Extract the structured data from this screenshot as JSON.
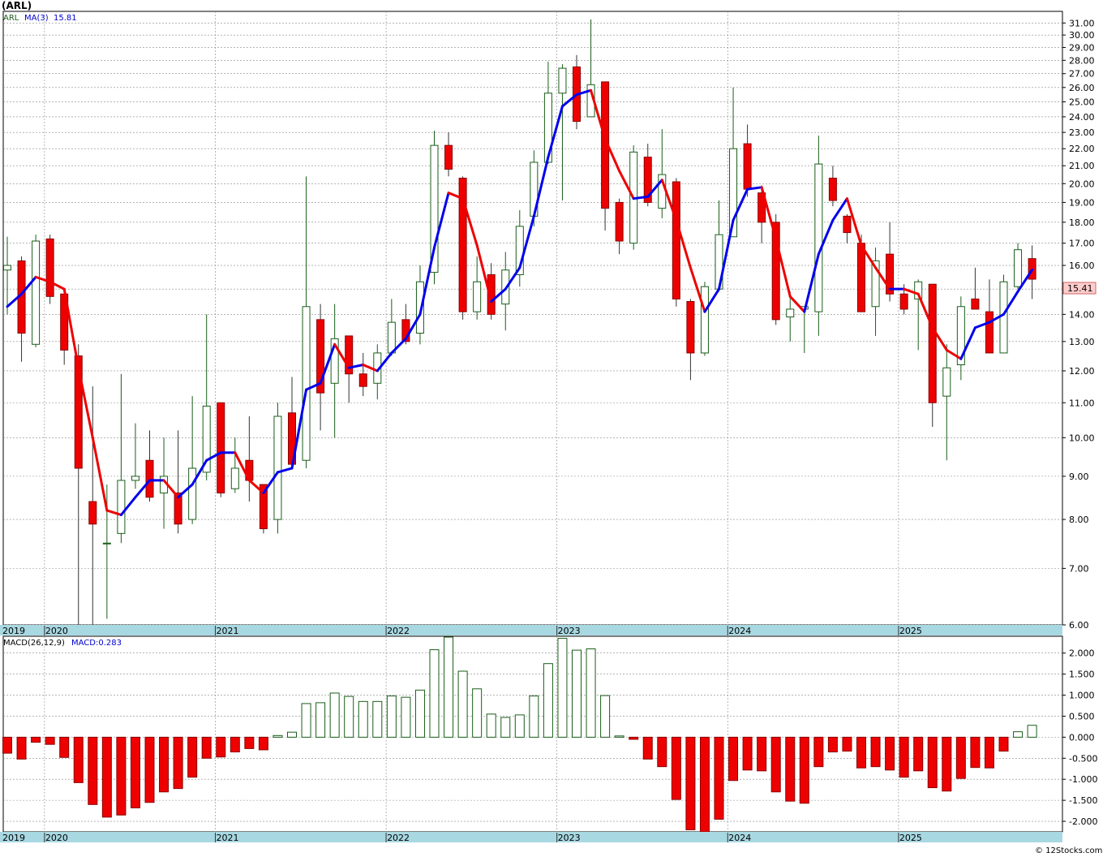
{
  "header": {
    "symbol_title": "(ARL)",
    "legend_symbol": "ARL",
    "legend_ma": "MA(3)",
    "legend_ma_value": "15.81",
    "macd_label": "MACD(26,12,9)",
    "macd_value": "MACD:0.283",
    "last_price_tag": "15.41",
    "copyright": "© 12Stocks.com"
  },
  "colors": {
    "up_candle_stroke": "#1a5e1a",
    "up_candle_fill": "#ffffff",
    "down_candle_fill": "#ee0000",
    "ma_up": "#0000ee",
    "ma_down": "#ee0000",
    "grid": "#888888",
    "axis_band": "#a8d8e2",
    "price_tag_bg": "#ffcccc"
  },
  "chart_data": [
    {
      "type": "candlestick",
      "name": "price",
      "y_scale": "log",
      "ylim": [
        6.0,
        32.0
      ],
      "y_ticks": [
        6,
        7,
        8,
        9,
        10,
        11,
        12,
        13,
        14,
        15,
        16,
        17,
        18,
        19,
        20,
        21,
        22,
        23,
        24,
        25,
        26,
        27,
        28,
        29,
        30,
        31
      ],
      "y_tick_labels": [
        "6.00",
        "7.00",
        "8.00",
        "9.00",
        "10.00",
        "11.00",
        "12.00",
        "13.00",
        "14.00",
        "15.00",
        "16.00",
        "17.00",
        "18.00",
        "19.00",
        "20.00",
        "21.00",
        "22.00",
        "23.00",
        "24.00",
        "25.00",
        "26.00",
        "27.00",
        "28.00",
        "29.00",
        "30.00",
        "31.00"
      ],
      "x_year_labels": [
        "2019",
        "2020",
        "2021",
        "2022",
        "2023",
        "2024",
        "2025"
      ],
      "grid": true,
      "ma_period": 3,
      "candles": [
        {
          "o": 15.8,
          "h": 17.3,
          "l": 14.0,
          "c": 16.0
        },
        {
          "o": 16.2,
          "h": 16.4,
          "l": 12.3,
          "c": 13.3
        },
        {
          "o": 12.9,
          "h": 17.4,
          "l": 12.8,
          "c": 17.1
        },
        {
          "o": 17.2,
          "h": 17.4,
          "l": 14.4,
          "c": 14.7
        },
        {
          "o": 14.8,
          "h": 14.8,
          "l": 12.2,
          "c": 12.7
        },
        {
          "o": 12.5,
          "h": 12.9,
          "l": 5.9,
          "c": 9.2
        },
        {
          "o": 8.4,
          "h": 11.5,
          "l": 5.9,
          "c": 7.9
        },
        {
          "o": 7.5,
          "h": 8.8,
          "l": 6.1,
          "c": 7.5
        },
        {
          "o": 7.7,
          "h": 11.9,
          "l": 7.5,
          "c": 8.9
        },
        {
          "o": 8.9,
          "h": 10.4,
          "l": 8.7,
          "c": 9.0
        },
        {
          "o": 9.4,
          "h": 10.2,
          "l": 8.4,
          "c": 8.5
        },
        {
          "o": 8.6,
          "h": 10.0,
          "l": 7.8,
          "c": 9.0
        },
        {
          "o": 8.6,
          "h": 10.2,
          "l": 7.7,
          "c": 7.9
        },
        {
          "o": 8.0,
          "h": 11.2,
          "l": 7.9,
          "c": 9.2
        },
        {
          "o": 9.1,
          "h": 14.0,
          "l": 8.9,
          "c": 10.9
        },
        {
          "o": 11.0,
          "h": 11.0,
          "l": 8.5,
          "c": 8.6
        },
        {
          "o": 8.7,
          "h": 10.0,
          "l": 8.6,
          "c": 9.2
        },
        {
          "o": 9.4,
          "h": 10.6,
          "l": 8.4,
          "c": 8.9
        },
        {
          "o": 8.8,
          "h": 8.8,
          "l": 7.7,
          "c": 7.8
        },
        {
          "o": 8.0,
          "h": 11.0,
          "l": 7.7,
          "c": 10.6
        },
        {
          "o": 10.7,
          "h": 11.8,
          "l": 9.2,
          "c": 9.3
        },
        {
          "o": 9.4,
          "h": 20.4,
          "l": 9.2,
          "c": 14.3
        },
        {
          "o": 13.8,
          "h": 14.4,
          "l": 10.2,
          "c": 11.3
        },
        {
          "o": 11.6,
          "h": 14.4,
          "l": 10.0,
          "c": 13.1
        },
        {
          "o": 13.2,
          "h": 13.2,
          "l": 11.0,
          "c": 11.9
        },
        {
          "o": 11.9,
          "h": 12.6,
          "l": 11.2,
          "c": 11.5
        },
        {
          "o": 11.6,
          "h": 12.9,
          "l": 11.1,
          "c": 12.6
        },
        {
          "o": 12.6,
          "h": 14.6,
          "l": 12.5,
          "c": 13.7
        },
        {
          "o": 13.8,
          "h": 14.4,
          "l": 12.9,
          "c": 13.0
        },
        {
          "o": 13.3,
          "h": 16.0,
          "l": 12.9,
          "c": 15.3
        },
        {
          "o": 15.7,
          "h": 23.1,
          "l": 15.2,
          "c": 22.2
        },
        {
          "o": 22.2,
          "h": 23.0,
          "l": 20.4,
          "c": 20.8
        },
        {
          "o": 20.3,
          "h": 20.4,
          "l": 13.8,
          "c": 14.1
        },
        {
          "o": 14.1,
          "h": 16.4,
          "l": 13.8,
          "c": 15.3
        },
        {
          "o": 15.6,
          "h": 16.1,
          "l": 13.8,
          "c": 14.0
        },
        {
          "o": 14.4,
          "h": 16.6,
          "l": 13.4,
          "c": 15.8
        },
        {
          "o": 15.6,
          "h": 18.6,
          "l": 15.1,
          "c": 17.8
        },
        {
          "o": 18.3,
          "h": 21.9,
          "l": 17.8,
          "c": 21.2
        },
        {
          "o": 21.2,
          "h": 27.9,
          "l": 21.1,
          "c": 25.6
        },
        {
          "o": 25.6,
          "h": 27.7,
          "l": 19.1,
          "c": 27.4
        },
        {
          "o": 27.5,
          "h": 28.4,
          "l": 23.2,
          "c": 23.7
        },
        {
          "o": 24.0,
          "h": 31.3,
          "l": 24.0,
          "c": 26.2
        },
        {
          "o": 26.4,
          "h": 26.4,
          "l": 17.6,
          "c": 18.7
        },
        {
          "o": 19.0,
          "h": 19.2,
          "l": 16.5,
          "c": 17.1
        },
        {
          "o": 17.0,
          "h": 22.2,
          "l": 16.7,
          "c": 21.8
        },
        {
          "o": 21.5,
          "h": 22.3,
          "l": 18.8,
          "c": 19.0
        },
        {
          "o": 18.7,
          "h": 23.2,
          "l": 18.2,
          "c": 20.5
        },
        {
          "o": 20.1,
          "h": 20.3,
          "l": 14.3,
          "c": 14.6
        },
        {
          "o": 14.5,
          "h": 14.6,
          "l": 11.7,
          "c": 12.6
        },
        {
          "o": 12.6,
          "h": 15.3,
          "l": 12.5,
          "c": 15.1
        },
        {
          "o": 15.0,
          "h": 19.1,
          "l": 14.9,
          "c": 17.4
        },
        {
          "o": 17.3,
          "h": 26.0,
          "l": 17.3,
          "c": 22.0
        },
        {
          "o": 22.3,
          "h": 23.5,
          "l": 19.3,
          "c": 19.7
        },
        {
          "o": 19.5,
          "h": 19.9,
          "l": 17.0,
          "c": 18.0
        },
        {
          "o": 18.0,
          "h": 18.4,
          "l": 13.6,
          "c": 13.8
        },
        {
          "o": 13.9,
          "h": 14.9,
          "l": 13.0,
          "c": 14.2
        },
        {
          "o": 14.2,
          "h": 14.3,
          "l": 12.6,
          "c": 14.3
        },
        {
          "o": 14.1,
          "h": 22.8,
          "l": 13.2,
          "c": 21.1
        },
        {
          "o": 20.3,
          "h": 21.0,
          "l": 18.8,
          "c": 19.1
        },
        {
          "o": 18.3,
          "h": 18.4,
          "l": 17.0,
          "c": 17.5
        },
        {
          "o": 17.0,
          "h": 17.4,
          "l": 14.1,
          "c": 14.1
        },
        {
          "o": 14.3,
          "h": 16.8,
          "l": 13.2,
          "c": 16.2
        },
        {
          "o": 16.5,
          "h": 18.0,
          "l": 14.5,
          "c": 14.8
        },
        {
          "o": 14.8,
          "h": 15.2,
          "l": 14.0,
          "c": 14.2
        },
        {
          "o": 14.6,
          "h": 15.4,
          "l": 12.7,
          "c": 15.3
        },
        {
          "o": 15.2,
          "h": 15.2,
          "l": 10.3,
          "c": 11.0
        },
        {
          "o": 11.2,
          "h": 12.9,
          "l": 9.4,
          "c": 12.1
        },
        {
          "o": 12.2,
          "h": 14.7,
          "l": 11.7,
          "c": 14.3
        },
        {
          "o": 14.6,
          "h": 15.9,
          "l": 14.2,
          "c": 14.2
        },
        {
          "o": 14.1,
          "h": 15.4,
          "l": 12.6,
          "c": 12.6
        },
        {
          "o": 12.6,
          "h": 15.6,
          "l": 12.6,
          "c": 15.3
        },
        {
          "o": 15.1,
          "h": 17.0,
          "l": 15.0,
          "c": 16.7
        },
        {
          "o": 16.3,
          "h": 16.9,
          "l": 14.6,
          "c": 15.41
        }
      ],
      "ma": [
        14.3,
        14.8,
        15.5,
        15.3,
        15.0,
        12.1,
        10.0,
        8.2,
        8.1,
        8.5,
        8.9,
        8.9,
        8.5,
        8.8,
        9.4,
        9.6,
        9.6,
        8.9,
        8.6,
        9.1,
        9.2,
        11.4,
        11.6,
        12.9,
        12.1,
        12.2,
        12.0,
        12.6,
        13.1,
        14.0,
        16.8,
        19.5,
        19.2,
        16.9,
        14.5,
        15.0,
        15.9,
        18.3,
        21.5,
        24.7,
        25.5,
        25.8,
        22.6,
        20.7,
        19.2,
        19.3,
        20.2,
        18.1,
        15.9,
        14.1,
        15.0,
        18.1,
        19.7,
        19.8,
        17.2,
        14.7,
        14.1,
        16.5,
        18.1,
        19.2,
        16.9,
        15.9,
        15.0,
        15.0,
        14.8,
        13.5,
        12.7,
        12.4,
        13.5,
        13.7,
        14.0,
        14.9,
        15.81
      ]
    },
    {
      "type": "bar",
      "name": "macd-histogram",
      "ylim": [
        -2.25,
        2.4
      ],
      "y_ticks": [
        -2.0,
        -1.5,
        -1.0,
        -0.5,
        0.0,
        0.5,
        1.0,
        1.5,
        2.0
      ],
      "y_tick_labels": [
        "-2.000",
        "-1.500",
        "-1.000",
        "-0.500",
        "0.000",
        "0.500",
        "1.000",
        "1.500",
        "2.000"
      ],
      "x_year_labels": [
        "2019",
        "2020",
        "2021",
        "2022",
        "2023",
        "2024",
        "2025"
      ],
      "values": [
        -0.38,
        -0.52,
        -0.12,
        -0.17,
        -0.48,
        -1.08,
        -1.6,
        -1.9,
        -1.85,
        -1.68,
        -1.55,
        -1.3,
        -1.22,
        -0.95,
        -0.5,
        -0.47,
        -0.35,
        -0.27,
        -0.3,
        0.04,
        0.12,
        0.8,
        0.82,
        1.05,
        0.97,
        0.85,
        0.85,
        0.98,
        0.95,
        1.12,
        2.08,
        2.38,
        1.57,
        1.15,
        0.55,
        0.47,
        0.53,
        0.98,
        1.75,
        2.35,
        2.07,
        2.1,
        0.99,
        0.03,
        -0.05,
        -0.52,
        -0.7,
        -1.48,
        -2.2,
        -2.25,
        -1.95,
        -1.03,
        -0.78,
        -0.8,
        -1.3,
        -1.52,
        -1.57,
        -0.7,
        -0.35,
        -0.33,
        -0.73,
        -0.7,
        -0.78,
        -0.95,
        -0.8,
        -1.2,
        -1.28,
        -0.98,
        -0.72,
        -0.73,
        -0.33,
        0.13,
        0.283
      ]
    }
  ]
}
